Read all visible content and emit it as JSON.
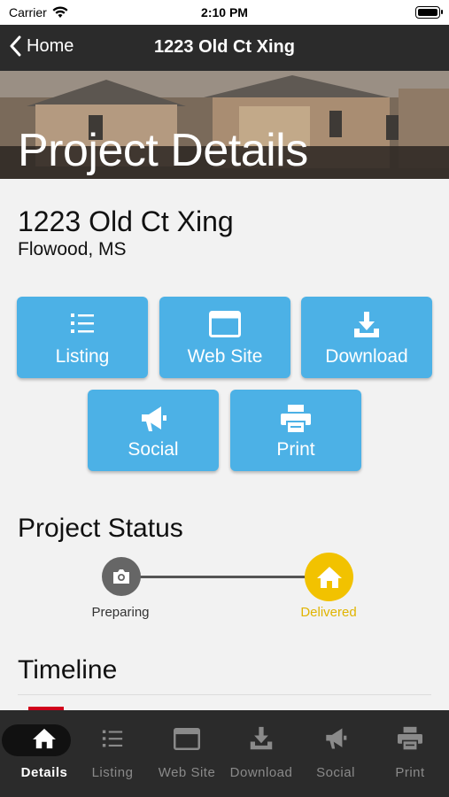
{
  "status_bar": {
    "carrier": "Carrier",
    "time": "2:10 PM"
  },
  "nav": {
    "back_label": "Home",
    "title": "1223 Old Ct Xing"
  },
  "hero": {
    "title": "Project Details"
  },
  "project": {
    "address": "1223 Old Ct Xing",
    "city": "Flowood, MS"
  },
  "actions": [
    {
      "label": "Listing",
      "icon": "list-icon"
    },
    {
      "label": "Web Site",
      "icon": "browser-window-icon"
    },
    {
      "label": "Download",
      "icon": "download-icon"
    },
    {
      "label": "Social",
      "icon": "megaphone-icon"
    },
    {
      "label": "Print",
      "icon": "printer-icon"
    }
  ],
  "project_status": {
    "title": "Project Status",
    "steps": [
      {
        "label": "Preparing",
        "icon": "camera-icon",
        "color": "#666666"
      },
      {
        "label": "Delivered",
        "icon": "home-icon",
        "color": "#f2c200"
      }
    ]
  },
  "timeline": {
    "title": "Timeline"
  },
  "tabs": [
    {
      "label": "Details",
      "icon": "home-icon",
      "active": true
    },
    {
      "label": "Listing",
      "icon": "list-icon",
      "active": false
    },
    {
      "label": "Web Site",
      "icon": "browser-window-icon",
      "active": false
    },
    {
      "label": "Download",
      "icon": "download-icon",
      "active": false
    },
    {
      "label": "Social",
      "icon": "megaphone-icon",
      "active": false
    },
    {
      "label": "Print",
      "icon": "printer-icon",
      "active": false
    }
  ],
  "colors": {
    "accent": "#4cb1e6",
    "delivered": "#f2c200",
    "bar": "#2b2b2b"
  }
}
